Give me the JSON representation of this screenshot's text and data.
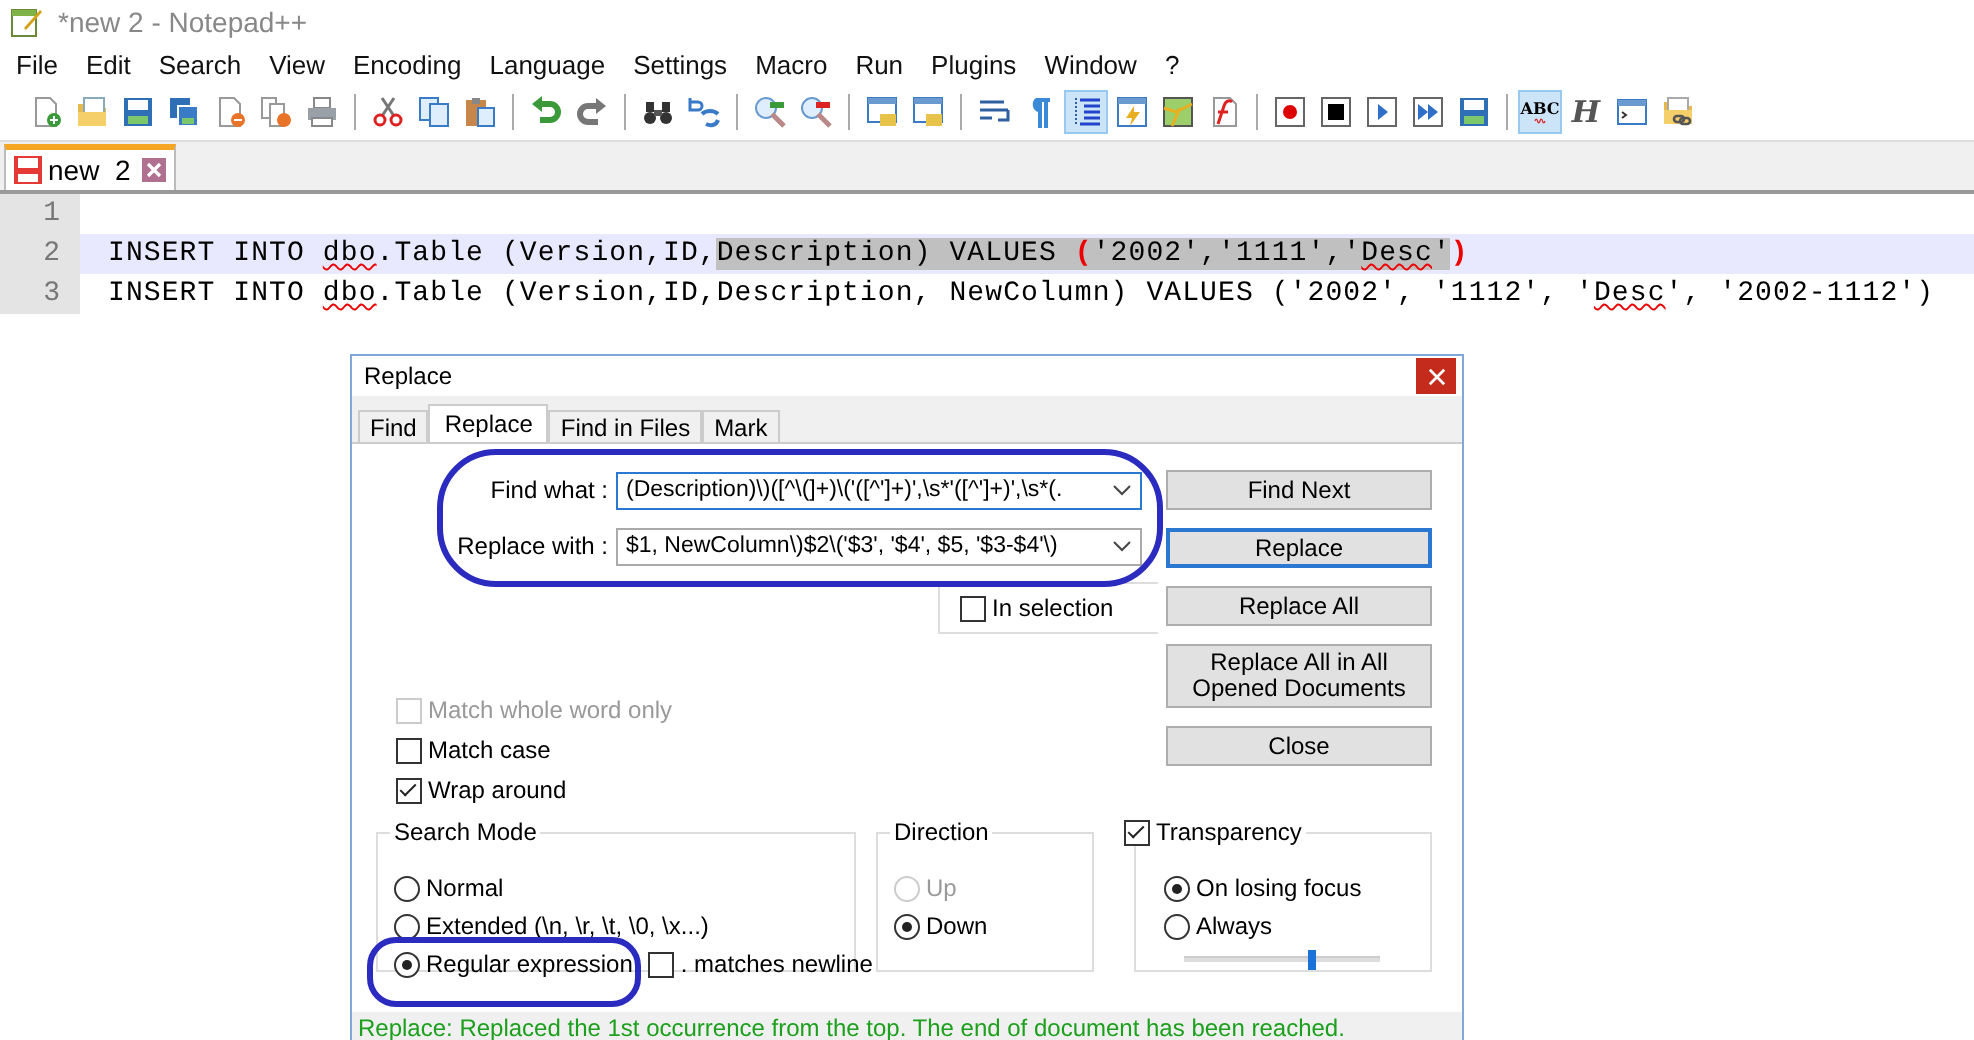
{
  "window": {
    "title": "*new  2 - Notepad++"
  },
  "menu": [
    "File",
    "Edit",
    "Search",
    "View",
    "Encoding",
    "Language",
    "Settings",
    "Macro",
    "Run",
    "Plugins",
    "Window",
    "?"
  ],
  "toolbar": [
    {
      "pressed": false
    },
    {
      "pressed": false
    },
    {
      "pressed": false
    },
    {
      "pressed": false
    },
    {
      "pressed": false
    },
    {
      "pressed": false
    },
    {
      "pressed": false
    },
    {
      "pressed": false
    },
    {
      "pressed": false
    },
    {
      "pressed": false
    },
    {
      "pressed": false
    },
    {
      "pressed": false
    },
    {
      "pressed": false
    },
    {
      "pressed": false
    },
    {
      "pressed": false
    },
    {
      "pressed": false
    },
    {
      "pressed": false
    },
    {
      "pressed": false
    },
    {
      "pressed": false
    },
    {
      "pressed": false
    },
    {
      "pressed": true
    },
    {
      "pressed": false
    },
    {
      "pressed": false
    },
    {
      "pressed": false
    },
    {
      "pressed": false
    },
    {
      "pressed": false
    },
    {
      "pressed": false
    },
    {
      "pressed": false
    },
    {
      "pressed": false
    },
    {
      "pressed": true,
      "glyph": "ABC"
    },
    {
      "pressed": false,
      "glyph": "H"
    },
    {
      "pressed": false
    },
    {
      "pressed": false
    }
  ],
  "tabs": [
    {
      "label": "new  2",
      "selected": true,
      "modified": true
    }
  ],
  "editor": {
    "lines": [
      {
        "number": "1",
        "current": false
      },
      {
        "number": "2",
        "current": true,
        "segments": [
          {
            "text": "INSERT INTO ",
            "selected": false,
            "misspelled": false,
            "brace": false
          },
          {
            "text": "dbo",
            "selected": false,
            "misspelled": true,
            "brace": false
          },
          {
            "text": ".Table (Version,ID,",
            "selected": false,
            "misspelled": false,
            "brace": false
          },
          {
            "text": "Description) VALUES ",
            "selected": true,
            "misspelled": false,
            "brace": false
          },
          {
            "text": "(",
            "selected": true,
            "misspelled": false,
            "brace": true
          },
          {
            "text": "'2002','1111','",
            "selected": true,
            "misspelled": false,
            "brace": false
          },
          {
            "text": "Desc",
            "selected": true,
            "misspelled": true,
            "brace": false
          },
          {
            "text": "'",
            "selected": true,
            "misspelled": false,
            "brace": false
          },
          {
            "text": ")",
            "selected": false,
            "misspelled": false,
            "brace": true
          }
        ]
      },
      {
        "number": "3",
        "current": false,
        "segments": [
          {
            "text": "INSERT INTO ",
            "selected": false,
            "misspelled": false,
            "brace": false
          },
          {
            "text": "dbo",
            "selected": false,
            "misspelled": true,
            "brace": false
          },
          {
            "text": ".Table (Version,ID,Description, NewColumn) VALUES ('2002', '1112', '",
            "selected": false,
            "misspelled": false,
            "brace": false
          },
          {
            "text": "Desc",
            "selected": false,
            "misspelled": true,
            "brace": false
          },
          {
            "text": "', '2002-1112')",
            "selected": false,
            "misspelled": false,
            "brace": false
          }
        ]
      }
    ]
  },
  "dialog": {
    "title": "Replace",
    "tabs": [
      {
        "label": "Find",
        "selected": false
      },
      {
        "label": "Replace",
        "selected": true
      },
      {
        "label": "Find in Files",
        "selected": false
      },
      {
        "label": "Mark",
        "selected": false
      }
    ],
    "find_what": {
      "label": "Find what :",
      "value": "(Description)\\)([^\\(]+)\\('([^']+)',\\s*'([^']+)',\\s*(."
    },
    "replace_with": {
      "label": "Replace with :",
      "value": "$1, NewColumn\\)$2\\('$3', '$4', $5, '$3-$4'\\)"
    },
    "in_selection": {
      "label": "In selection",
      "checked": false
    },
    "buttons": [
      {
        "label": "Find Next",
        "default": false
      },
      {
        "label": "Replace",
        "default": true
      },
      {
        "label": "Replace All",
        "default": false
      },
      {
        "label": "Replace All in All Opened Documents",
        "default": false
      },
      {
        "label": "Close",
        "default": false
      }
    ],
    "options": [
      {
        "label": "Match whole word only",
        "checked": false,
        "disabled": true
      },
      {
        "label": "Match case",
        "checked": false,
        "disabled": false
      },
      {
        "label": "Wrap around",
        "checked": true,
        "disabled": false
      }
    ],
    "search_mode": {
      "title": "Search Mode",
      "options": [
        {
          "label": "Normal",
          "selected": false
        },
        {
          "label": "Extended (\\n, \\r, \\t, \\0, \\x...)",
          "selected": false
        },
        {
          "label": "Regular expression",
          "selected": true
        }
      ],
      "matches_newline": {
        "label": ". matches newline",
        "checked": false
      }
    },
    "direction": {
      "title": "Direction",
      "options": [
        {
          "label": "Up",
          "selected": false,
          "disabled": true
        },
        {
          "label": "Down",
          "selected": true,
          "disabled": false
        }
      ]
    },
    "transparency": {
      "label": "Transparency",
      "checked": true,
      "options": [
        {
          "label": "On losing focus",
          "selected": true
        },
        {
          "label": "Always",
          "selected": false
        }
      ],
      "level": 0.65
    },
    "status": "Replace: Replaced the 1st occurrence from the top. The end of document has been reached."
  }
}
